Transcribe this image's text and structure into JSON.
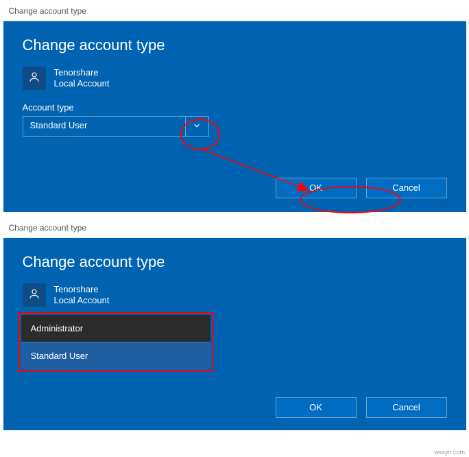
{
  "top": {
    "window_title": "Change account type",
    "page_title": "Change account type",
    "user": {
      "name": "Tenorshare",
      "type": "Local Account"
    },
    "field_label": "Account type",
    "dropdown_value": "Standard User",
    "ok_label": "OK",
    "cancel_label": "Cancel"
  },
  "bottom": {
    "window_title": "Change account type",
    "page_title": "Change account type",
    "user": {
      "name": "Tenorshare",
      "type": "Local Account"
    },
    "options": {
      "admin": "Administrator",
      "standard": "Standard User"
    },
    "ok_label": "OK",
    "cancel_label": "Cancel"
  },
  "watermark": "wsxyn.com"
}
